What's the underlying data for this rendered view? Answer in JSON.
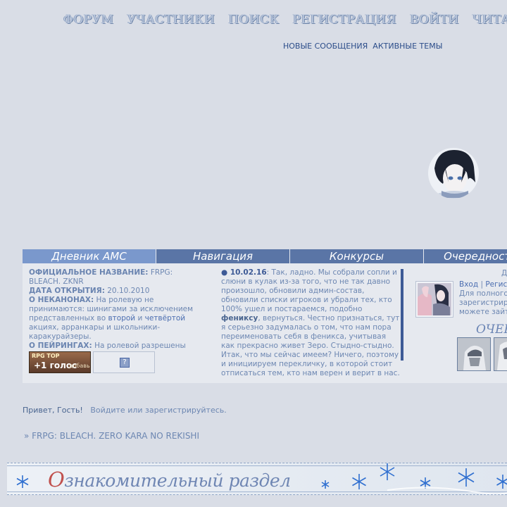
{
  "nav": {
    "items": [
      "ФОРУМ",
      "УЧАСТНИКИ",
      "ПОИСК",
      "РЕГИСТРАЦИЯ",
      "ВОЙТИ",
      "ЧИТАТЕ"
    ]
  },
  "subnav": {
    "new_messages": "НОВЫЕ СООБЩЕНИЯ",
    "active_topics": "АКТИВНЫЕ ТЕМЫ"
  },
  "panel": {
    "tabs": [
      "Дневник АМС",
      "Навигация",
      "Конкурсы",
      "Очередность"
    ],
    "info": {
      "name_label": "ОФИЦИАЛЬНОЕ НАЗВАНИЕ:",
      "name_value": "FRPG: BLEACH. ZKNR",
      "date_label": "ДАТА ОТКРЫТИЯ:",
      "date_value": "20.10.2010",
      "canon_label": "О НЕКАНОНАХ:",
      "canon_text_1": "На ролевую не принимаются: шинигами за исключением представленных во",
      "canon_link_1": "второй",
      "canon_and": "и",
      "canon_link_2": "четвёртой",
      "canon_text_2": "акциях, арранкары и школьники-каракурайзеры.",
      "pairing_label": "О ПЕЙРИНГАХ:",
      "pairing_text": "На ролевой разрешены пейринги."
    },
    "rpgtop": {
      "line1": "RPG TOP",
      "line2": "+1 голос",
      "line3": "добавь"
    },
    "help_icon": "?",
    "news": {
      "date": "● 10.02.16",
      "text_1": ": Так, ладно. Мы собрали сопли и слюни в кулак из-за того, что не так давно произошло, обновили админ-состав, обновили списки игроков и убрали тех, кто 100% ушел и постараемся, подобно",
      "bold_word": "фениксу",
      "text_2": ", вернуться. Честно признаться, тут я серьезно задумалась о том, что нам пора переименовать себя в феникса, учитывая как прекрасно живет Зеро. Стыдно-стыдно.",
      "text_3": "Итак, что мы сейчас имеем? Ничего, поэтому и инициируем перекличку, в которой стоит отписаться тем, кто нам верен и верит в нас. А"
    },
    "right": {
      "welcome_partial": "Д",
      "login_link": "Вход",
      "separator": "|",
      "register_link": "Регист",
      "login_text_1": "Для полного",
      "login_text_2": "зарегистриру",
      "login_text_3": "можете зайт",
      "queue_title": "ОЧЕР"
    }
  },
  "greeting": {
    "text": "Привет, Гость!",
    "login": "Войдите",
    "or": "или",
    "register": "зарегистрируйтесь."
  },
  "breadcrumb": "» FRPG: BLEACH. ZERO KARA NO REKISHI",
  "section": {
    "title_first": "О",
    "title_rest": "знакомительный раздел"
  },
  "colors": {
    "background": "#d9dde6",
    "tab_active": "#7a98cc",
    "tab": "#5a75a6",
    "text": "#6d87b2",
    "link": "#4a6db0"
  }
}
